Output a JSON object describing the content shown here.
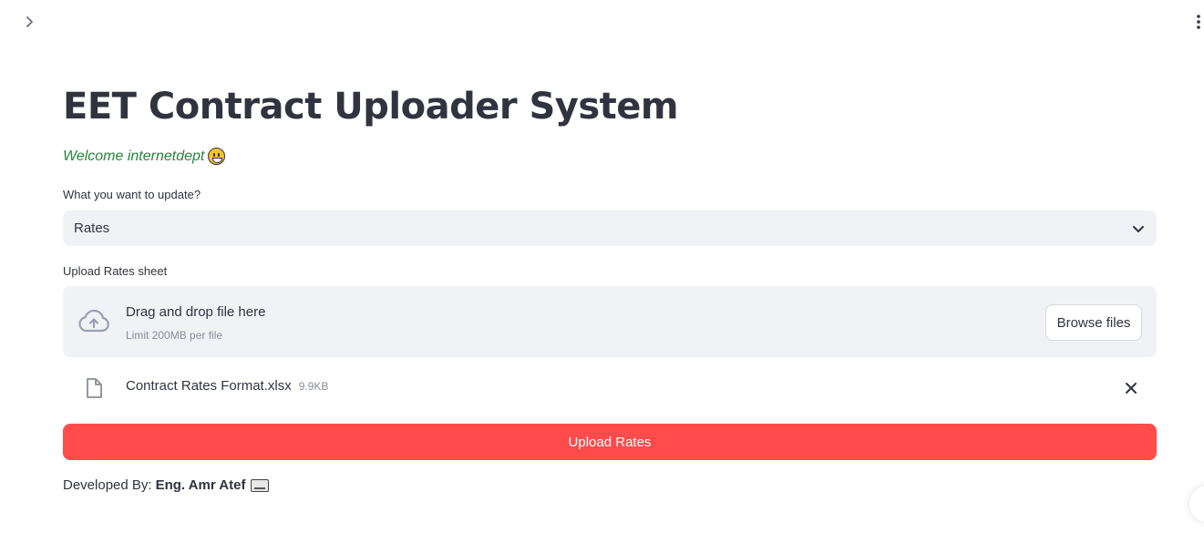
{
  "icons": {
    "sidebar_toggle": "chevron-right-icon",
    "menu": "kebab-menu-icon",
    "upload": "cloud-upload-icon",
    "file": "file-icon",
    "remove": "close-icon",
    "dropdown": "chevron-down-icon"
  },
  "colors": {
    "primary": "#ff4b4b",
    "welcome_text": "#21873a",
    "panel_bg": "#f0f2f6",
    "text": "#31333f",
    "muted": "#8a8d96"
  },
  "header": {
    "title": "EET Contract Uploader System",
    "welcome": "Welcome internetdept"
  },
  "form": {
    "select_label": "What you want to update?",
    "select_value": "Rates",
    "upload_label": "Upload Rates sheet",
    "dropzone_title": "Drag and drop file here",
    "dropzone_limit": "Limit 200MB per file",
    "browse_label": "Browse files",
    "file": {
      "name": "Contract Rates Format.xlsx",
      "size": "9.9KB"
    },
    "submit_label": "Upload Rates"
  },
  "footer": {
    "prefix": "Developed By:",
    "author": "Eng. Amr Atef"
  }
}
